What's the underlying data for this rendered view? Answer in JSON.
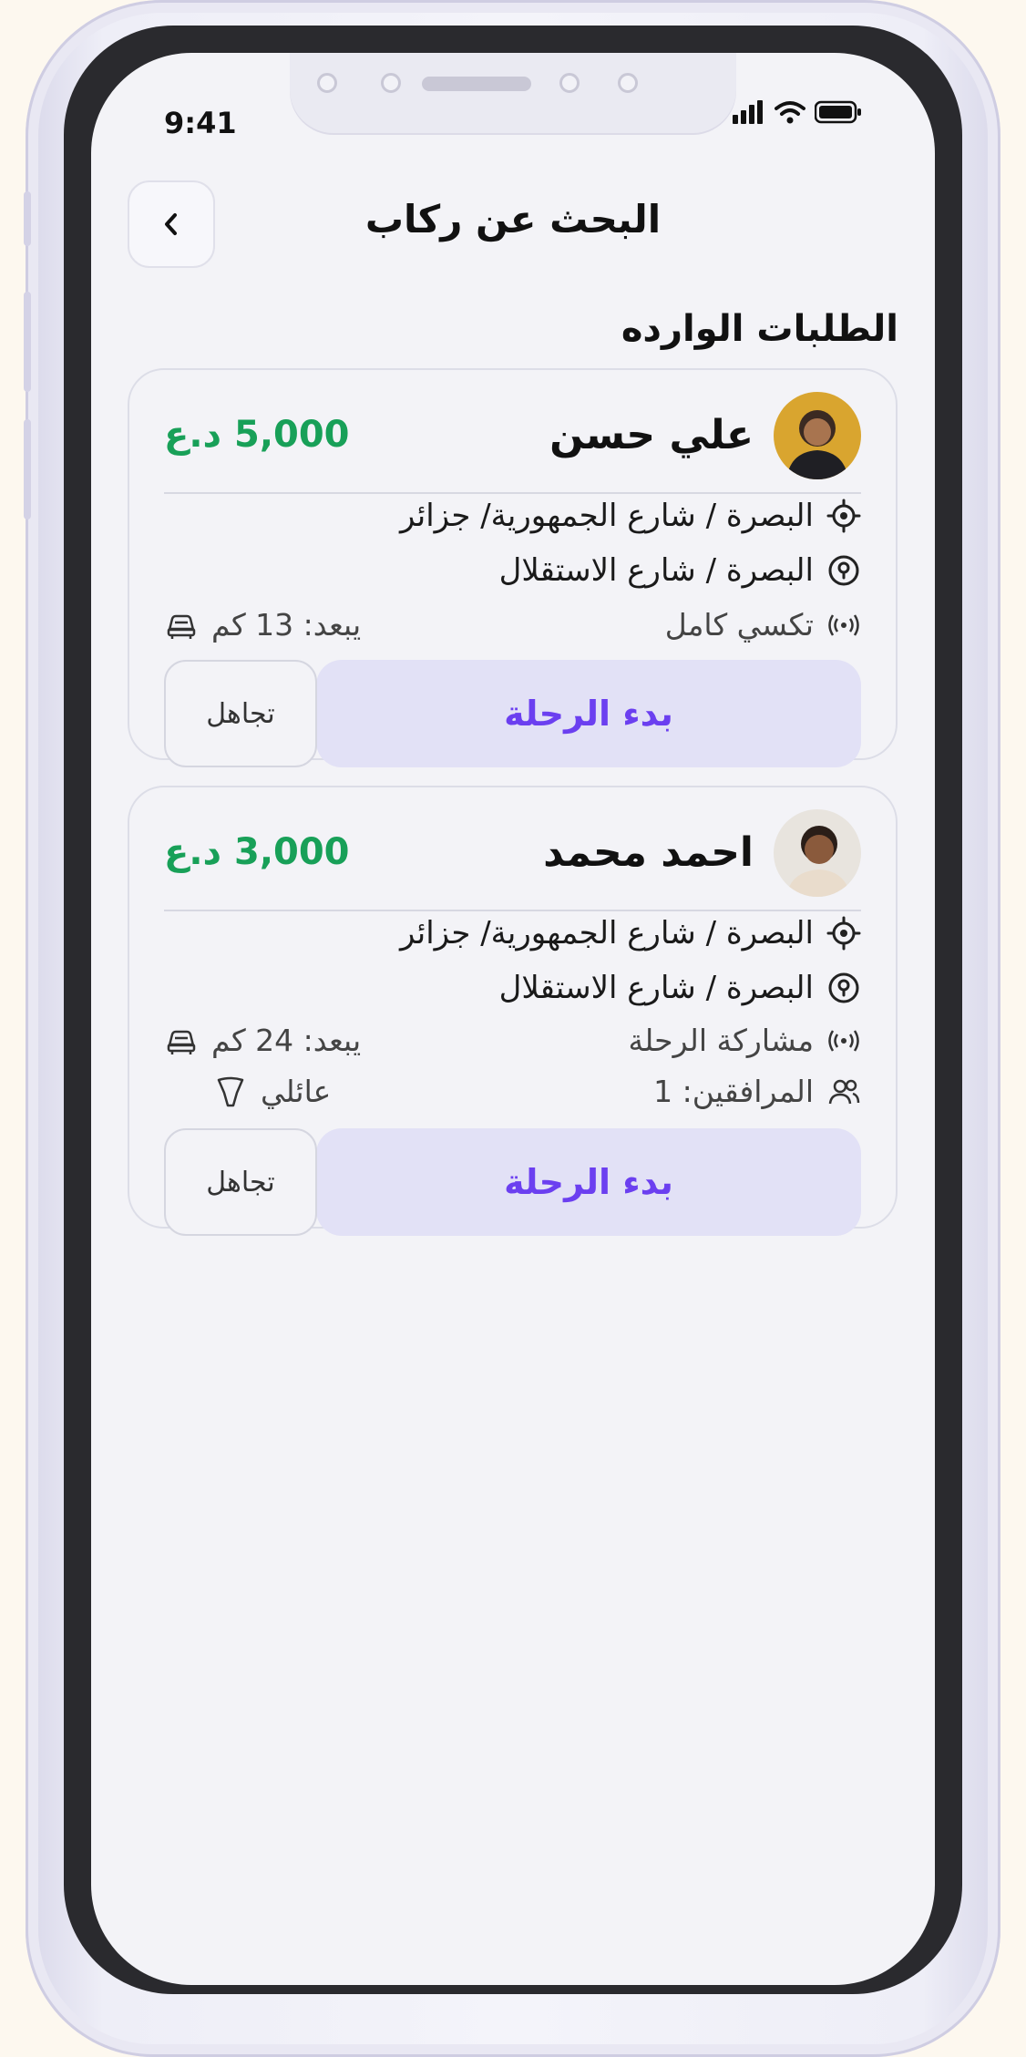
{
  "status_bar": {
    "time": "9:41"
  },
  "header": {
    "title": "البحث عن ركاب"
  },
  "section": {
    "title": "الطلبات الوارده"
  },
  "requests": [
    {
      "name": "علي حسن",
      "price": "5,000 د.ع",
      "pickup": "البصرة / شارع الجمهورية/ جزائر",
      "dropoff": "البصرة / شارع الاستقلال",
      "ride_type": "تكسي كامل",
      "distance": "يبعد: 13 كم",
      "start_label": "بدء الرحلة",
      "ignore_label": "تجاهل"
    },
    {
      "name": "احمد محمد",
      "price": "3,000 د.ع",
      "pickup": "البصرة / شارع الجمهورية/ جزائر",
      "dropoff": "البصرة / شارع الاستقلال",
      "ride_type": "مشاركة الرحلة",
      "distance": "يبعد: 24 كم",
      "companions": "المرافقين: 1",
      "category": "عائلي",
      "start_label": "بدء الرحلة",
      "ignore_label": "تجاهل"
    }
  ],
  "colors": {
    "price": "#18a058",
    "accent": "#6b3ff0",
    "button_bg": "#e2e1f6"
  },
  "icons": [
    "chevron-left-icon",
    "signal-icon",
    "wifi-icon",
    "battery-icon",
    "target-icon",
    "location-pin-icon",
    "broadcast-icon",
    "car-icon",
    "users-icon",
    "family-icon"
  ]
}
